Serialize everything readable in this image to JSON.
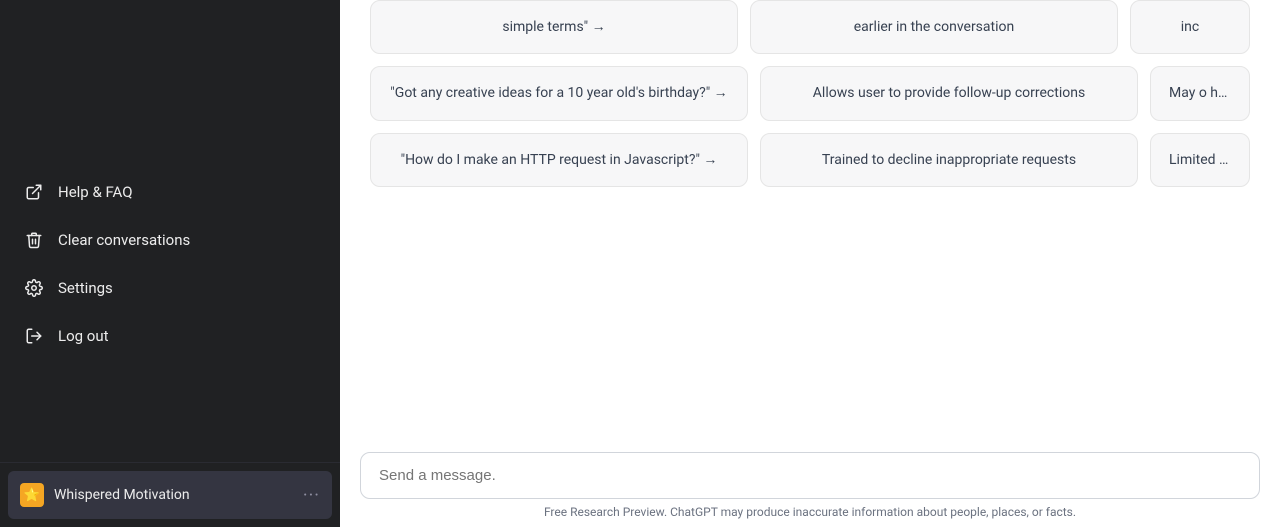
{
  "sidebar": {
    "menu_items": [
      {
        "id": "help-faq",
        "label": "Help & FAQ",
        "icon": "external-link"
      },
      {
        "id": "clear-conversations",
        "label": "Clear conversations",
        "icon": "trash"
      },
      {
        "id": "settings",
        "label": "Settings",
        "icon": "gear"
      },
      {
        "id": "log-out",
        "label": "Log out",
        "icon": "logout"
      }
    ],
    "active_conversation": {
      "title": "Whispered Motivation",
      "icon": "⭐",
      "dots": "···"
    }
  },
  "main": {
    "cards": {
      "row1": [
        {
          "text": "simple terms\" →",
          "partial": false
        },
        {
          "text": "earlier in the conversation",
          "partial": false
        },
        {
          "text": "inc",
          "partial": true
        }
      ],
      "row2": [
        {
          "text": "\"Got any creative ideas for a 10 year old's birthday?\" →",
          "partial": false
        },
        {
          "text": "Allows user to provide follow-up corrections",
          "partial": false
        },
        {
          "text": "May o harmful",
          "partial": true
        }
      ],
      "row3": [
        {
          "text": "\"How do I make an HTTP request in Javascript?\" →",
          "partial": false
        },
        {
          "text": "Trained to decline inappropriate requests",
          "partial": false
        },
        {
          "text": "Limited k e",
          "partial": true
        }
      ]
    },
    "input_placeholder": "Send a message.",
    "footer_text": "Free Research Preview. ChatGPT may produce inaccurate information about people, places, or facts."
  }
}
